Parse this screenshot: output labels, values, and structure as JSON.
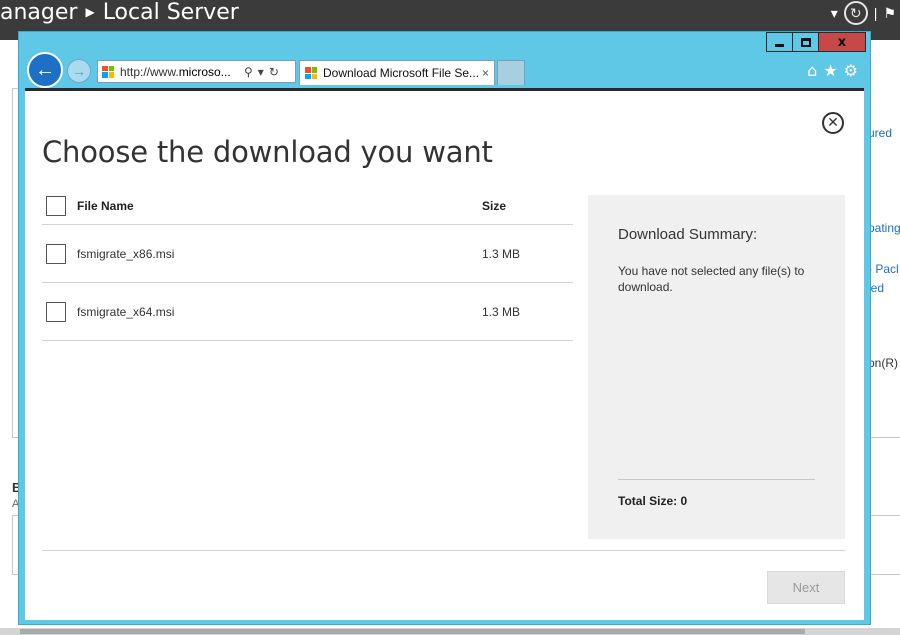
{
  "background": {
    "breadcrumb_partial": "anager",
    "breadcrumb_current": "Local Server",
    "right_snippets": [
      "ured",
      "pating",
      ") Pacl",
      "led",
      "on(R) C"
    ],
    "left_b": "B",
    "left_a": "A"
  },
  "browser": {
    "address": "http://www.microso...",
    "address_prefix": "http://www.",
    "address_host": "microso...",
    "tab_title": "Download Microsoft File Se...",
    "tab_close": "×",
    "caption": {
      "minimize": "",
      "maximize": "",
      "close": "x"
    },
    "tools": {
      "home": "⌂",
      "favorites": "★",
      "settings": "⚙"
    }
  },
  "dialog": {
    "close": "✕",
    "title": "Choose the download you want",
    "columns": {
      "name": "File Name",
      "size": "Size"
    },
    "files": [
      {
        "name": "fsmigrate_x86.msi",
        "size": "1.3 MB"
      },
      {
        "name": "fsmigrate_x64.msi",
        "size": "1.3 MB"
      }
    ],
    "summary": {
      "title": "Download Summary:",
      "message": "You have not selected any file(s) to download.",
      "total": "Total Size: 0"
    },
    "next": "Next"
  },
  "colors": {
    "ie_frame": "#5ec8e6",
    "back_button": "#1e70c6",
    "close_button": "#c74848",
    "summary_bg": "#f0f0f0",
    "link": "#1f6ebc"
  }
}
